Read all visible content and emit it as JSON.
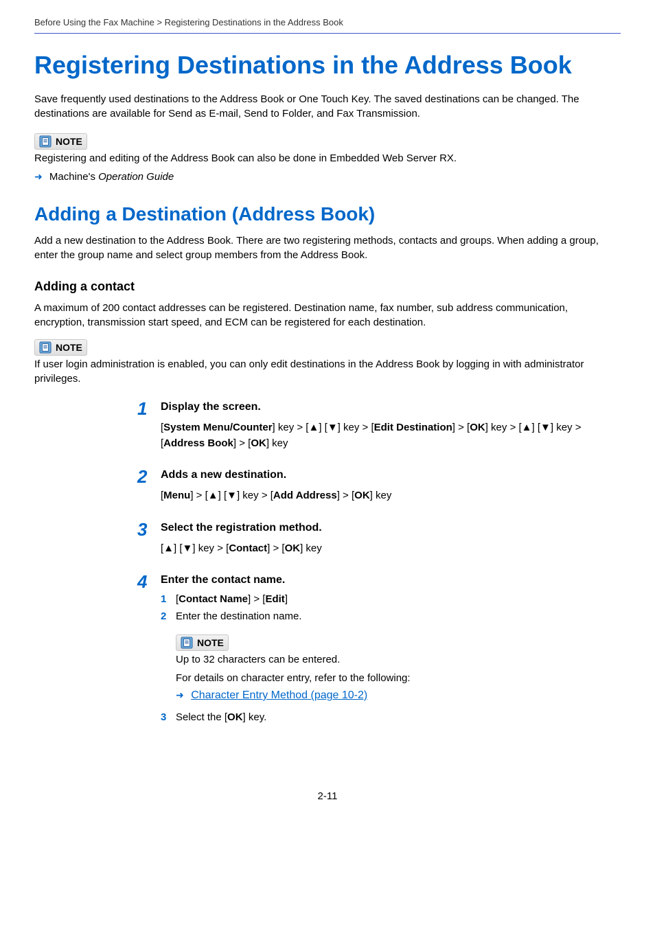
{
  "breadcrumb": "Before Using the Fax Machine > Registering Destinations in the Address Book",
  "h1": "Registering Destinations in the Address Book",
  "intro": "Save frequently used destinations to the Address Book or One Touch Key. The saved destinations can be changed. The destinations are available for Send as E-mail, Send to Folder, and Fax Transmission.",
  "note1_label": "NOTE",
  "note1_text": "Registering and editing of the Address Book can also be done in Embedded Web Server RX.",
  "ref1_prefix": "Machine's ",
  "ref1_italic": "Operation Guide",
  "h2": "Adding a Destination (Address Book)",
  "h2_intro": "Add a new destination to the Address Book. There are two registering methods, contacts and groups. When adding a group, enter the group name and select group members from the Address Book.",
  "h3": "Adding a contact",
  "h3_intro": "A maximum of 200 contact addresses can be registered. Destination name, fax number, sub address communication, encryption, transmission start speed, and ECM can be registered for each destination.",
  "note2_label": "NOTE",
  "note2_text": "If user login administration is enabled, you can only edit destinations in the Address Book by logging in with administrator privileges.",
  "steps": {
    "s1": {
      "num": "1",
      "title": "Display the screen.",
      "body": "[System Menu/Counter] key > [▲] [▼] key > [Edit Destination] > [OK] key > [▲] [▼] key > [Address Book] > [OK] key"
    },
    "s2": {
      "num": "2",
      "title": "Adds a new destination.",
      "body": "[Menu] > [▲] [▼] key > [Add Address] > [OK] key"
    },
    "s3": {
      "num": "3",
      "title": "Select the registration method.",
      "body": "[▲] [▼] key > [Contact] > [OK] key"
    },
    "s4": {
      "num": "4",
      "title": "Enter the contact name.",
      "sub1_num": "1",
      "sub1_text": "[Contact Name] > [Edit]",
      "sub2_num": "2",
      "sub2_text": "Enter the destination name.",
      "note_label": "NOTE",
      "note_line1": "Up to 32 characters can be entered.",
      "note_line2": "For details on character entry, refer to the following:",
      "note_link": "Character Entry Method (page 10-2)",
      "sub3_num": "3",
      "sub3_text_prefix": "Select the [",
      "sub3_text_bold": "OK",
      "sub3_text_suffix": "] key."
    }
  },
  "page_num": "2-11"
}
